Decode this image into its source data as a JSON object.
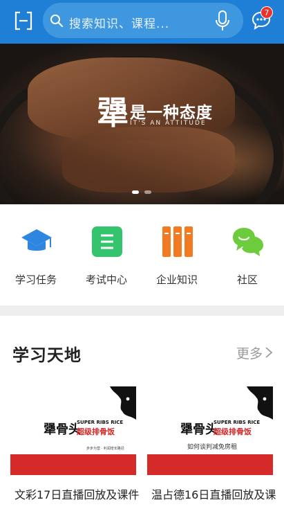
{
  "header": {
    "search_placeholder": "搜索知识、课程...",
    "message_badge": "7",
    "brand_color": "#1f7fd6"
  },
  "banner": {
    "slogan_char": "犟",
    "slogan_main": "是一种态度",
    "slogan_sub": "IT'S AN ATTITUDE",
    "slide_count": 2,
    "active_slide": 1
  },
  "quick_menu": [
    {
      "label": "学习任务",
      "icon": "graduation-cap-icon",
      "color": "#2f86e0"
    },
    {
      "label": "考试中心",
      "icon": "exam-list-icon",
      "color": "#35c46e"
    },
    {
      "label": "企业知识",
      "icon": "books-icon",
      "color": "#f27a22"
    },
    {
      "label": "社区",
      "icon": "chat-bubbles-icon",
      "color": "#6ccc3c"
    }
  ],
  "section": {
    "title": "学习天地",
    "more": "更多"
  },
  "cards": [
    {
      "title": "文彩17日直播回放及课件",
      "brand": "犟骨头",
      "brand_en": "SUPER RIBS RICE",
      "brand_red": "超级排骨饭",
      "sub": "",
      "tiny": "步步为营 · 利润增长路径"
    },
    {
      "title": "温占德16日直播回放及课",
      "brand": "犟骨头",
      "brand_en": "SUPER RIBS RICE",
      "brand_red": "超级排骨饭",
      "sub": "如何谈判减免房租",
      "tiny": ""
    }
  ]
}
